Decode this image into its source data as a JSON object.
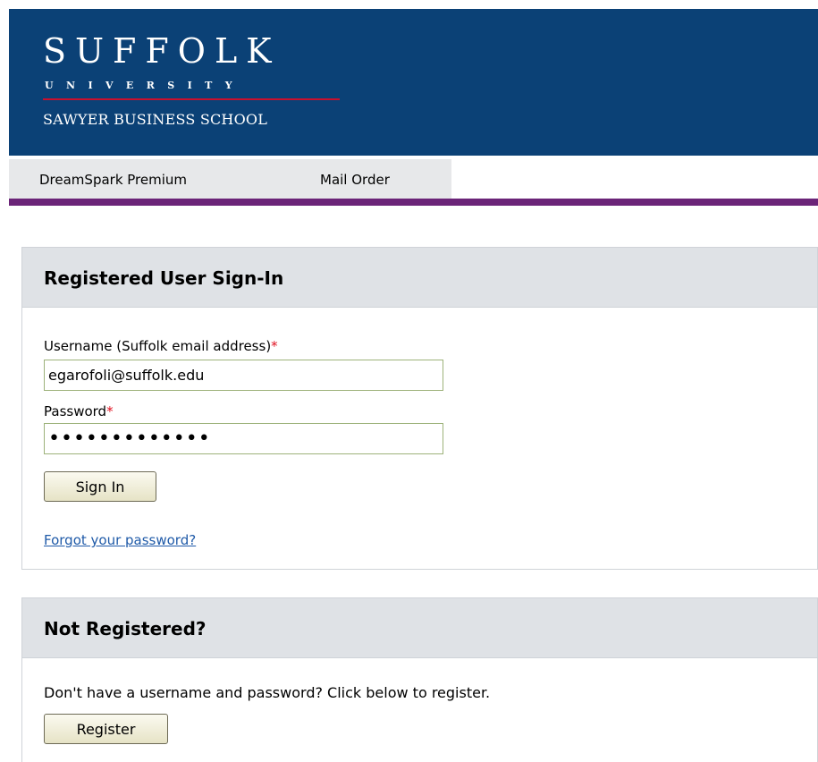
{
  "branding": {
    "name": "SUFFOLK",
    "subname": "UNIVERSITY",
    "school": "SAWYER BUSINESS SCHOOL",
    "banner_color": "#0b4176",
    "rule_color": "#c8102e"
  },
  "nav": {
    "items": [
      {
        "label": "DreamSpark Premium"
      },
      {
        "label": "Mail Order"
      }
    ],
    "accent_color": "#6b2478"
  },
  "signin": {
    "title": "Registered User Sign-In",
    "username_label": "Username (Suffolk email address)",
    "username_value": "egarofoli@suffolk.edu",
    "password_label": "Password",
    "password_value": "•••••••••••••",
    "required_marker": "*",
    "sign_in_button": "Sign In",
    "forgot_link": "Forgot your password?"
  },
  "register": {
    "title": "Not Registered?",
    "prompt": "Don't have a username and password? Click below to register.",
    "register_button": "Register"
  }
}
